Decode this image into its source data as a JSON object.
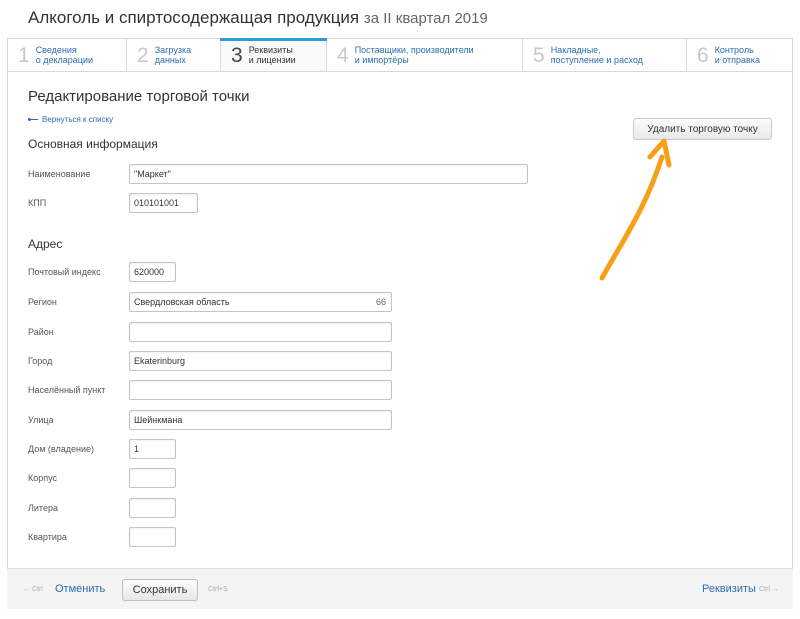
{
  "page": {
    "title": "Алкоголь и спиртосодержащая продукция",
    "period": "за II квартал 2019"
  },
  "steps": [
    {
      "num": "1",
      "label": "Сведения\nо декларации"
    },
    {
      "num": "2",
      "label": "Загрузка\nданных"
    },
    {
      "num": "3",
      "label": "Реквизиты\nи лицензии"
    },
    {
      "num": "4",
      "label": "Поставщики, производители\nи импортёры"
    },
    {
      "num": "5",
      "label": "Накладные,\nпоступление и расход"
    },
    {
      "num": "6",
      "label": "Контроль\nи отправка"
    }
  ],
  "form": {
    "heading": "Редактирование торговой точки",
    "back_link": "Вернуться к списку",
    "delete_button": "Удалить торговую точку",
    "main_section": "Основная информация",
    "address_section": "Адрес"
  },
  "fields": {
    "name": {
      "label": "Наименование",
      "value": "\"Маркет\""
    },
    "kpp": {
      "label": "КПП",
      "value": "010101001"
    },
    "postal": {
      "label": "Почтовый индекс",
      "value": "620000"
    },
    "region": {
      "label": "Регион",
      "value": "Свердловская область",
      "code": "66"
    },
    "district": {
      "label": "Район",
      "value": ""
    },
    "city": {
      "label": "Город",
      "value": "Ekaterinburg"
    },
    "settlement": {
      "label": "Населённый пункт",
      "value": ""
    },
    "street": {
      "label": "Улица",
      "value": "Шейнкмана"
    },
    "house": {
      "label": "Дом (владение)",
      "value": "1"
    },
    "building": {
      "label": "Корпус",
      "value": ""
    },
    "letter": {
      "label": "Литера",
      "value": ""
    },
    "apartment": {
      "label": "Квартира",
      "value": ""
    }
  },
  "footer": {
    "cancel_hint": "← Ctrl",
    "cancel_label": "Отменить",
    "save_label": "Сохранить",
    "save_hint": "Ctrl+S",
    "next_label": "Реквизиты",
    "next_hint": "Ctrl →"
  },
  "colors": {
    "accent": "#2f9bd6",
    "link": "#2b6cb0",
    "annotation_arrow": "#f5a018"
  }
}
